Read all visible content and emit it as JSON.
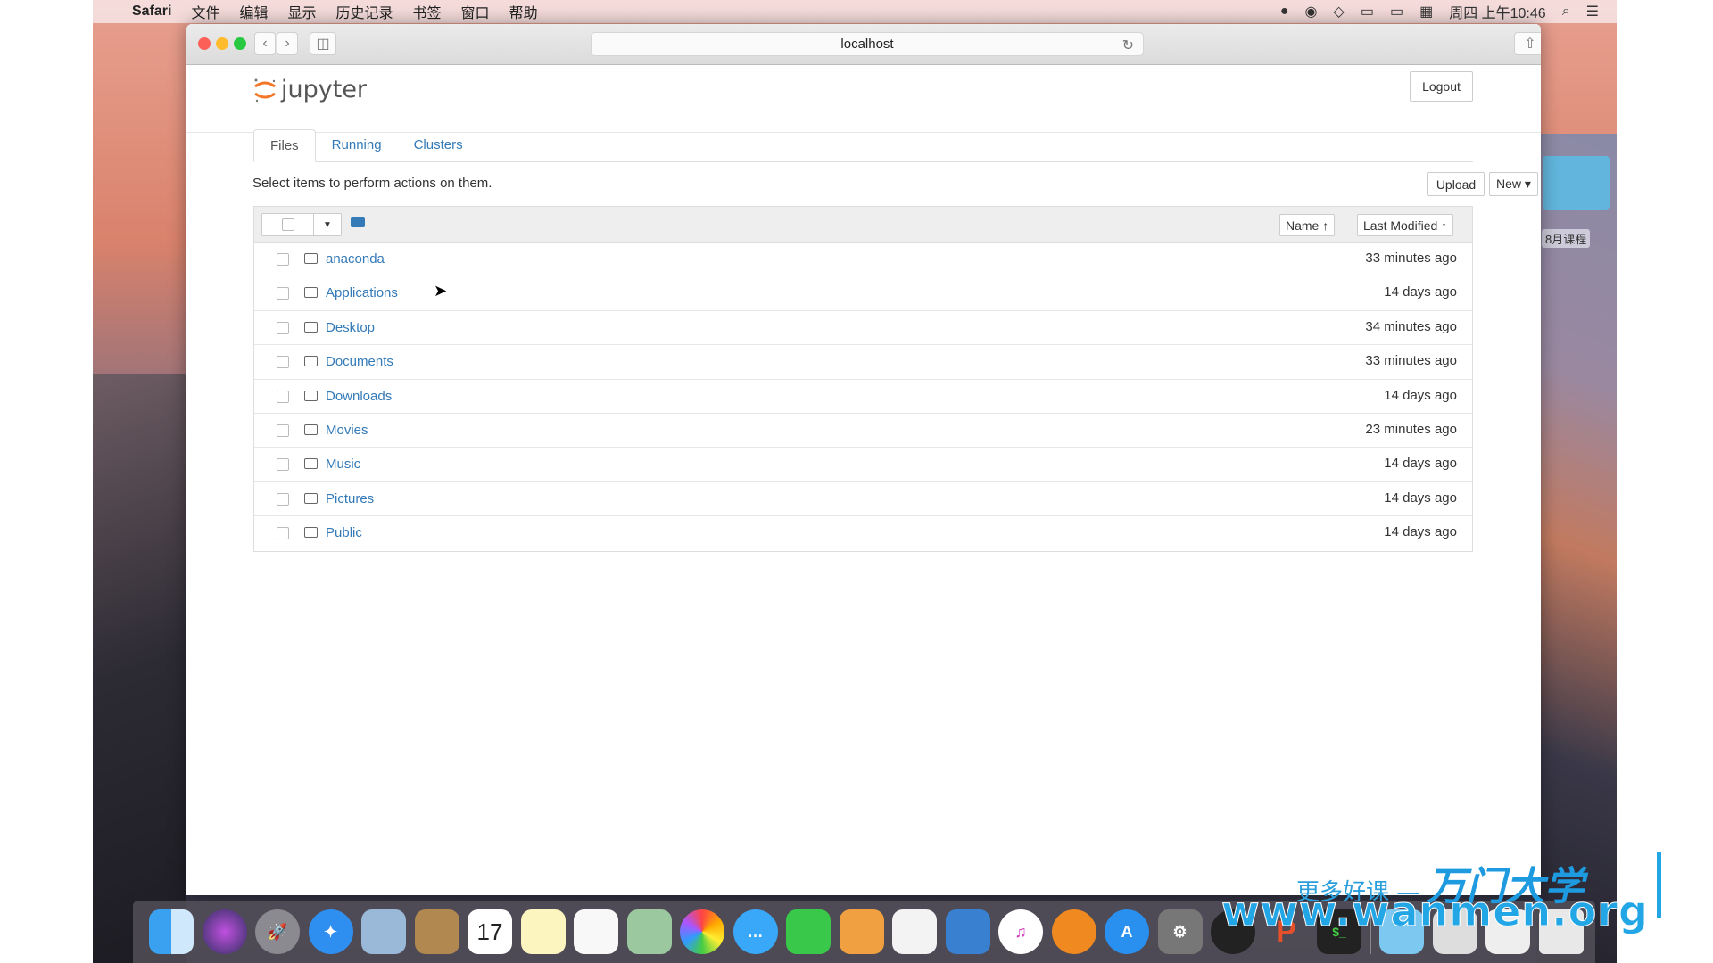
{
  "menubar": {
    "app": "Safari",
    "items": [
      "文件",
      "编辑",
      "显示",
      "历史记录",
      "书签",
      "窗口",
      "帮助"
    ],
    "clock": "周四 上午10:46"
  },
  "browser": {
    "url": "localhost"
  },
  "jupyter": {
    "logo_text": "jupyter",
    "logout": "Logout",
    "tabs": [
      {
        "label": "Files",
        "active": true
      },
      {
        "label": "Running"
      },
      {
        "label": "Clusters"
      }
    ],
    "hint": "Select items to perform actions on them.",
    "upload": "Upload",
    "new": "New ▾",
    "refresh_icon": "refresh-icon",
    "sort_name": "Name ↑",
    "sort_modified": "Last Modified ↑",
    "files": [
      {
        "name": "anaconda",
        "modified": "33 minutes ago"
      },
      {
        "name": "Applications",
        "modified": "14 days ago"
      },
      {
        "name": "Desktop",
        "modified": "34 minutes ago"
      },
      {
        "name": "Documents",
        "modified": "33 minutes ago"
      },
      {
        "name": "Downloads",
        "modified": "14 days ago"
      },
      {
        "name": "Movies",
        "modified": "23 minutes ago"
      },
      {
        "name": "Music",
        "modified": "14 days ago"
      },
      {
        "name": "Pictures",
        "modified": "14 days ago"
      },
      {
        "name": "Public",
        "modified": "14 days ago"
      }
    ]
  },
  "desktop": {
    "folder_label": "8月课程"
  },
  "dock": {
    "calendar_day": "17"
  },
  "watermark": {
    "line1": "更多好课 —",
    "brand": "万门大学",
    "url": "www.wanmen.org"
  },
  "colors": {
    "link": "#337ab7",
    "jupyter_orange": "#f37726"
  }
}
